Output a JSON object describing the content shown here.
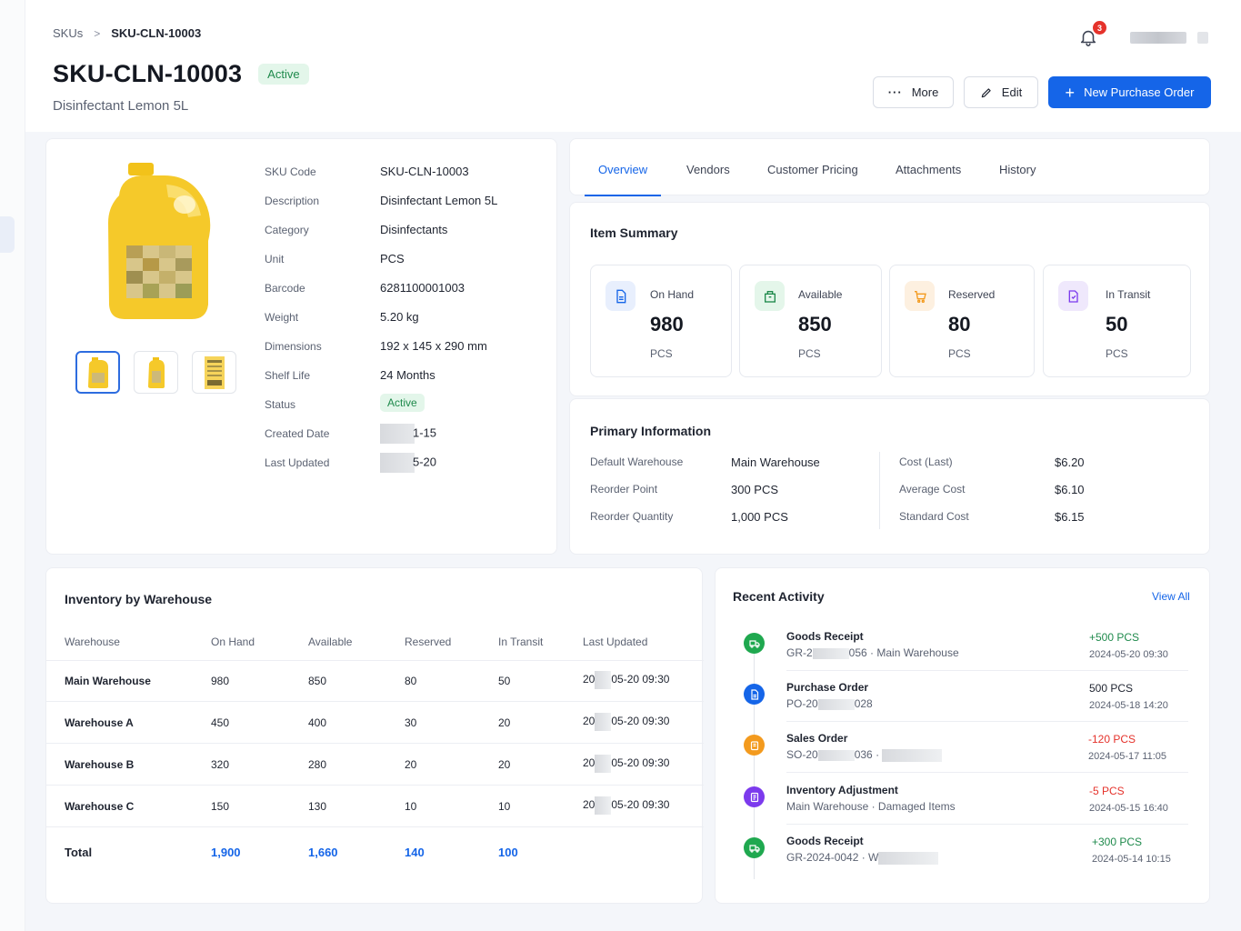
{
  "breadcrumb": {
    "root": "SKUs",
    "current": "SKU-CLN-10003"
  },
  "header": {
    "title": "SKU-CLN-10003",
    "status": "Active",
    "subtitle": "Disinfectant Lemon 5L",
    "notifications": "3",
    "more_label": "More",
    "edit_label": "Edit",
    "new_po_label": "New Purchase Order"
  },
  "colors": {
    "accent": "#1565e8",
    "success": "#1f8a4c",
    "danger": "#e5322b",
    "warning": "#f39a1e",
    "purple": "#7c3aed"
  },
  "details": {
    "sku_code_label": "SKU Code",
    "sku_code": "SKU-CLN-10003",
    "description_label": "Description",
    "description": "Disinfectant Lemon 5L",
    "category_label": "Category",
    "category": "Disinfectants",
    "unit_label": "Unit",
    "unit": "PCS",
    "barcode_label": "Barcode",
    "barcode": "6281100001003",
    "weight_label": "Weight",
    "weight": "5.20 kg",
    "dimensions_label": "Dimensions",
    "dimensions": "192 x 145 x 290 mm",
    "shelf_life_label": "Shelf Life",
    "shelf_life": "24 Months",
    "status_label": "Status",
    "status": "Active",
    "created_label": "Created Date",
    "created": "1-15",
    "updated_label": "Last Updated",
    "updated": "5-20"
  },
  "tabs": [
    {
      "label": "Overview"
    },
    {
      "label": "Vendors"
    },
    {
      "label": "Customer Pricing"
    },
    {
      "label": "Attachments"
    },
    {
      "label": "History"
    }
  ],
  "summary": {
    "title": "Item Summary",
    "stats": [
      {
        "label": "On Hand",
        "value": "980",
        "unit": "PCS",
        "icon": "document-icon"
      },
      {
        "label": "Available",
        "value": "850",
        "unit": "PCS",
        "icon": "box-icon"
      },
      {
        "label": "Reserved",
        "value": "80",
        "unit": "PCS",
        "icon": "cart-icon"
      },
      {
        "label": "In Transit",
        "value": "50",
        "unit": "PCS",
        "icon": "truck-icon"
      }
    ]
  },
  "primary": {
    "title": "Primary Information",
    "default_warehouse_label": "Default Warehouse",
    "default_warehouse": "Main Warehouse",
    "reorder_point_label": "Reorder Point",
    "reorder_point": "300 PCS",
    "reorder_qty_label": "Reorder Quantity",
    "reorder_qty": "1,000 PCS",
    "cost_last_label": "Cost (Last)",
    "cost_last": "$6.20",
    "avg_cost_label": "Average Cost",
    "avg_cost": "$6.10",
    "std_cost_label": "Standard Cost",
    "std_cost": "$6.15"
  },
  "inventory": {
    "title": "Inventory by Warehouse",
    "columns": [
      "Warehouse",
      "On Hand",
      "Available",
      "Reserved",
      "In Transit",
      "Last Updated"
    ],
    "rows": [
      {
        "warehouse": "Main Warehouse",
        "on_hand": "980",
        "available": "850",
        "reserved": "80",
        "in_transit": "50",
        "updated_a": "20",
        "updated_b": "05-20 09:30"
      },
      {
        "warehouse": "Warehouse A",
        "on_hand": "450",
        "available": "400",
        "reserved": "30",
        "in_transit": "20",
        "updated_a": "20",
        "updated_b": "05-20 09:30"
      },
      {
        "warehouse": "Warehouse B",
        "on_hand": "320",
        "available": "280",
        "reserved": "20",
        "in_transit": "20",
        "updated_a": "20",
        "updated_b": "05-20 09:30"
      },
      {
        "warehouse": "Warehouse C",
        "on_hand": "150",
        "available": "130",
        "reserved": "10",
        "in_transit": "10",
        "updated_a": "20",
        "updated_b": "05-20 09:30"
      }
    ],
    "total": {
      "label": "Total",
      "on_hand": "1,900",
      "available": "1,660",
      "reserved": "140",
      "in_transit": "100"
    }
  },
  "activity": {
    "title": "Recent Activity",
    "view_all": "View All",
    "items": [
      {
        "title": "Goods Receipt",
        "ref_a": "GR-2",
        "ref_b": "056",
        "detail": "· Main Warehouse",
        "qty": "+500 PCS",
        "time": "2024-05-20 09:30",
        "kind": "receipt"
      },
      {
        "title": "Purchase Order",
        "ref_a": "PO-20",
        "ref_b": "028",
        "detail": "",
        "qty": "500 PCS",
        "time": "2024-05-18 14:20",
        "kind": "po"
      },
      {
        "title": "Sales Order",
        "ref_a": "SO-20",
        "ref_b": "036",
        "detail": "·",
        "qty": "-120 PCS",
        "time": "2024-05-17 11:05",
        "kind": "sales"
      },
      {
        "title": "Inventory Adjustment",
        "ref_a": "Main Warehouse · Damaged Items",
        "ref_b": "",
        "detail": "",
        "qty": "-5 PCS",
        "time": "2024-05-15 16:40",
        "kind": "adjust"
      },
      {
        "title": "Goods Receipt",
        "ref_a": "GR-2024-0042 · W",
        "ref_b": "",
        "detail": "",
        "qty": "+300 PCS",
        "time": "2024-05-14 10:15",
        "kind": "receipt"
      }
    ]
  }
}
